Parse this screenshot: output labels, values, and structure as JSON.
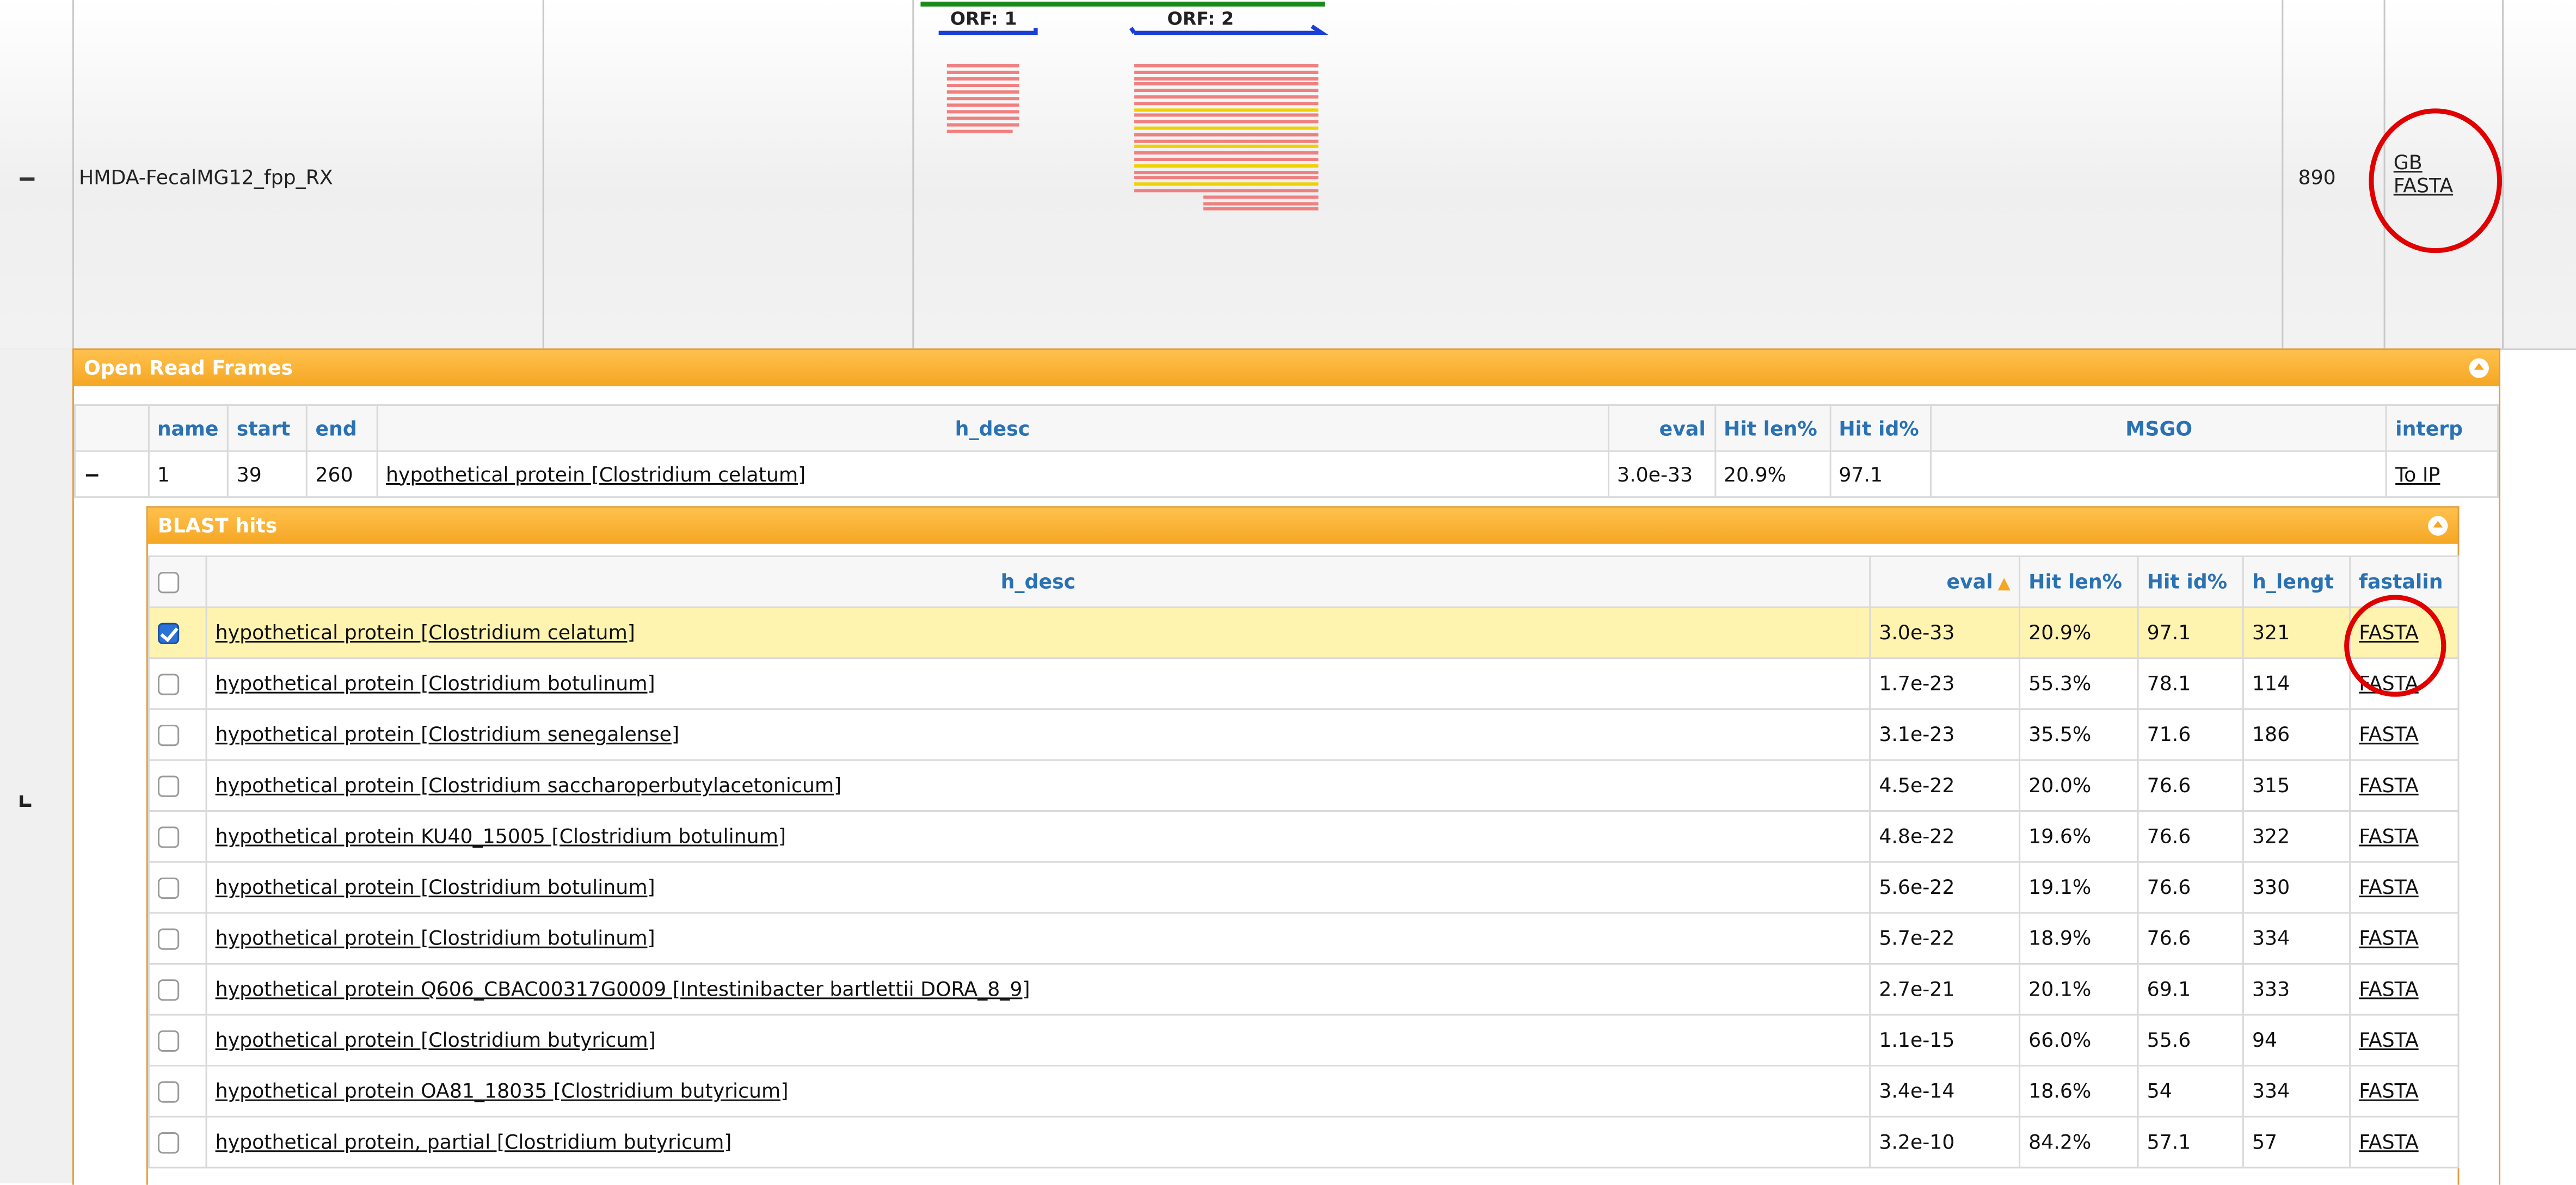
{
  "top_row": {
    "toggle": "−",
    "name": "HMDA-FecalMG12_fpp_RX",
    "length": "890",
    "links": {
      "gb": "GB",
      "fasta": "FASTA"
    },
    "orf_labels": [
      "ORF: 1",
      "ORF: 2"
    ]
  },
  "orf_panel": {
    "title": "Open Read Frames",
    "columns": [
      "name",
      "start",
      "end",
      "h_desc",
      "eval",
      "Hit len%",
      "Hit id%",
      "MSGO",
      "interp"
    ],
    "row": {
      "toggle": "−",
      "name": "1",
      "start": "39",
      "end": "260",
      "h_desc": "hypothetical protein [Clostridium celatum]",
      "eval": "3.0e-33",
      "hit_len": "20.9%",
      "hit_id": "97.1",
      "msgo": "",
      "interp": "To IP"
    }
  },
  "blast_panel": {
    "title": "BLAST hits",
    "columns": [
      "h_desc",
      "eval",
      "Hit len%",
      "Hit id%",
      "h_lengt",
      "fastalin"
    ],
    "rows": [
      {
        "desc": "hypothetical protein [Clostridium celatum]",
        "eval": "3.0e-33",
        "len": "20.9%",
        "id": "97.1",
        "hlen": "321",
        "fasta": "FASTA",
        "checked": true
      },
      {
        "desc": "hypothetical protein [Clostridium botulinum]",
        "eval": "1.7e-23",
        "len": "55.3%",
        "id": "78.1",
        "hlen": "114",
        "fasta": "FASTA",
        "checked": false
      },
      {
        "desc": "hypothetical protein [Clostridium senegalense]",
        "eval": "3.1e-23",
        "len": "35.5%",
        "id": "71.6",
        "hlen": "186",
        "fasta": "FASTA",
        "checked": false
      },
      {
        "desc": "hypothetical protein [Clostridium saccharoperbutylacetonicum]",
        "eval": "4.5e-22",
        "len": "20.0%",
        "id": "76.6",
        "hlen": "315",
        "fasta": "FASTA",
        "checked": false
      },
      {
        "desc": "hypothetical protein KU40_15005 [Clostridium botulinum]",
        "eval": "4.8e-22",
        "len": "19.6%",
        "id": "76.6",
        "hlen": "322",
        "fasta": "FASTA",
        "checked": false
      },
      {
        "desc": "hypothetical protein [Clostridium botulinum]",
        "eval": "5.6e-22",
        "len": "19.1%",
        "id": "76.6",
        "hlen": "330",
        "fasta": "FASTA",
        "checked": false
      },
      {
        "desc": "hypothetical protein [Clostridium botulinum]",
        "eval": "5.7e-22",
        "len": "18.9%",
        "id": "76.6",
        "hlen": "334",
        "fasta": "FASTA",
        "checked": false
      },
      {
        "desc": "hypothetical protein Q606_CBAC00317G0009 [Intestinibacter bartlettii DORA_8_9]",
        "eval": "2.7e-21",
        "len": "20.1%",
        "id": "69.1",
        "hlen": "333",
        "fasta": "FASTA",
        "checked": false
      },
      {
        "desc": "hypothetical protein [Clostridium butyricum]",
        "eval": "1.1e-15",
        "len": "66.0%",
        "id": "55.6",
        "hlen": "94",
        "fasta": "FASTA",
        "checked": false
      },
      {
        "desc": "hypothetical protein OA81_18035 [Clostridium butyricum]",
        "eval": "3.4e-14",
        "len": "18.6%",
        "id": "54",
        "hlen": "334",
        "fasta": "FASTA",
        "checked": false
      },
      {
        "desc": "hypothetical protein, partial [Clostridium butyricum]",
        "eval": "3.2e-10",
        "len": "84.2%",
        "id": "57.1",
        "hlen": "57",
        "fasta": "FASTA",
        "checked": false
      }
    ]
  },
  "colors": {
    "panel_header": "#f5a623",
    "header_text": "#2a72b3",
    "selected_row": "#fff3b0",
    "annotation_circle": "#e00000",
    "orf_arrow": "#1a3fd8",
    "contig_line": "#1a8a1a",
    "hit_pink": "#f08080",
    "hit_yellow": "#f2d000"
  }
}
